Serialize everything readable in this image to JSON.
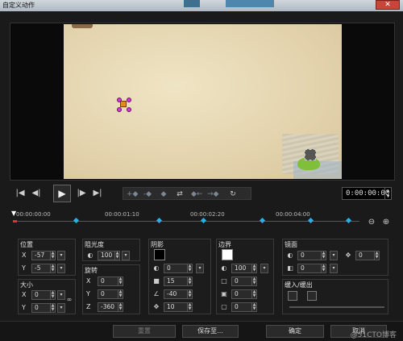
{
  "window": {
    "title": "自定义动作",
    "close_glyph": "✕"
  },
  "preview": {
    "icons": {
      "handle": "selection-handle"
    }
  },
  "transport": {
    "buttons": [
      "|◀",
      "◀|",
      "▶",
      "|▶",
      "▶|"
    ],
    "keyframe_buttons": [
      "+◆",
      "-◆",
      "◆",
      "⇄",
      "◆←",
      "→◆",
      "↻"
    ],
    "timecode": "0:00:00:00"
  },
  "timeline": {
    "ticks": [
      "00:00:00:00",
      "00:00:01:10",
      "00:00:02:20",
      "00:00:04:00"
    ],
    "keyframes": [
      0.18,
      0.42,
      0.55,
      0.72,
      0.86,
      0.97
    ],
    "zoom_out": "⊖",
    "zoom_in": "⊕"
  },
  "panels": {
    "position": {
      "label": "位置",
      "x": "-57",
      "y": "-5"
    },
    "size": {
      "label": "大小",
      "x": "0",
      "y": "0"
    },
    "opacity": {
      "label": "阻光度",
      "value": "100"
    },
    "rotation": {
      "label": "旋转",
      "x": "0",
      "y": "0",
      "z": "-360"
    },
    "shadow": {
      "label": "阴影",
      "v1": "0",
      "v2": "15",
      "v3": "-40",
      "v4": "10",
      "color": "#000000"
    },
    "border": {
      "label": "边界",
      "v1": "100",
      "v2": "0",
      "v3": "0",
      "v4": "0",
      "color": "#ffffff"
    },
    "mirror": {
      "label": "镜面",
      "v1": "0",
      "v2": "0",
      "v3": "0"
    },
    "fade": {
      "label": "缓入/缓出"
    }
  },
  "footer": {
    "reset": "重置",
    "save_as": "保存至...",
    "ok": "确定",
    "cancel": "取消",
    "watermark": "@51CTO博客"
  },
  "colors": {
    "accent_keyframe": "#2ab0e6",
    "handle": "#d23ad0",
    "object": "#e28a1c"
  }
}
